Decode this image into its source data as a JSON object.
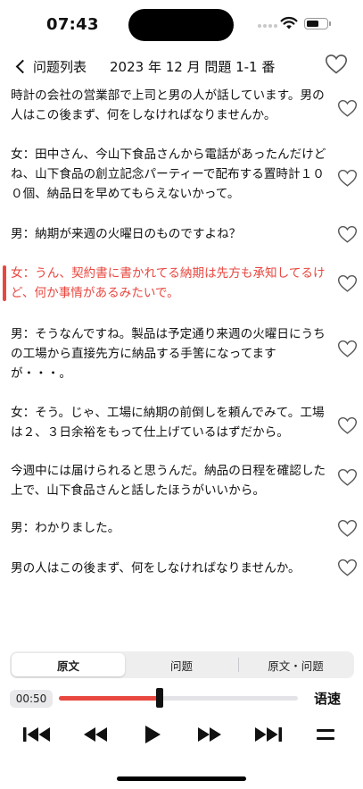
{
  "status_bar": {
    "time": "07:43"
  },
  "nav": {
    "back_label": "问题列表",
    "title": "2023 年 12 月 問題 1-1 番"
  },
  "sentences": [
    "時計の会社の営業部で上司と男の人が話しています。男の人はこの後まず、何をしなければなりませんか。",
    "女：田中さん、今山下食品さんから電話があったんだけどね、山下食品の創立記念パーティーで配布する置時計１００個、納品日を早めてもらえないかって。",
    "男：納期が来週の火曜日のものですよね？",
    "女：うん、契約書に書かれてる納期は先方も承知してるけど、何か事情があるみたいで。",
    "男：そうなんですね。製品は予定通り来週の火曜日にうちの工場から直接先方に納品する手筈になってますが・・・。",
    "女：そう。じゃ、工場に納期の前倒しを頼んでみて。工場は２、３日余裕をもって仕上げているはずだから。",
    "今週中には届けられると思うんだ。納品の日程を確認した上で、山下食品さんと話したほうがいいから。",
    "男：わかりました。",
    "男の人はこの後まず、何をしなければなりませんか。"
  ],
  "active_sentence_index": 3,
  "tabs": [
    {
      "label": "原文",
      "selected": true
    },
    {
      "label": "问题",
      "selected": false
    },
    {
      "label": "原文・问题",
      "selected": false
    }
  ],
  "player": {
    "current_time": "00:50",
    "progress": 0.42,
    "speed_label": "语速"
  },
  "colors": {
    "accent": "#e8473f",
    "text": "#111111"
  },
  "icons": [
    "back-chevron-icon",
    "heart-outline-icon",
    "skip-to-start-icon",
    "rewind-icon",
    "play-icon",
    "fast-forward-icon",
    "skip-to-end-icon",
    "menu-icon",
    "wifi-icon",
    "battery-icon"
  ]
}
